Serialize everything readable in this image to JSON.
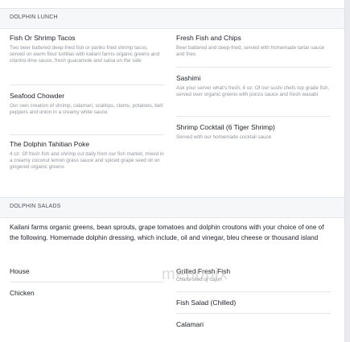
{
  "lunch": {
    "header": "DOLPHIN LUNCH",
    "left": [
      {
        "name": "Fish Or Shrimp Tacos",
        "desc": "Two beer battered deep-fried fish or panko fried shrimp tacos, served on warm flour tortillas with kailani farms organic greens and cilantro-lime sauce, fresh guacamole and salsa on the side"
      },
      {
        "name": "Seafood Chowder",
        "desc": "Our own creation of shrimp, calamari, scallops, clams, potatoes, bell peppers and onion in a creamy white sauce"
      },
      {
        "name": "The Dolphin Tahitian Poke",
        "desc": "4 oz. Of fresh fish and shrimp cut daily from our fish market, mixed in a creamy coconut lemon grass sauce and spiced grape seed oil on gingered organic greens"
      }
    ],
    "right": [
      {
        "name": "Fresh Fish and Chips",
        "desc": "Beer battered and deep-fried, served with homemade tartar sauce and fries"
      },
      {
        "name": "Sashimi",
        "desc": "Ask your server what's fresh, 4 oz. Of our sushi chefs top grade fish, served over organic greens with ponzu sauce and fresh wasabi"
      },
      {
        "name": "Shrimp Cocktail (6 Tiger Shrimp)",
        "desc": "Served with our homemade cocktail sauce"
      }
    ]
  },
  "salads": {
    "header": "DOLPHIN SALADS",
    "intro": "Kailani farms organic greens, bean sprouts, grape tomatoes and dolphin croutons with your choice of one of the following. Homemade dolphin dressing, which include, oil and vinegar, bleu cheese or thousand island",
    "left": [
      {
        "name": "House"
      },
      {
        "name": "Chicken"
      }
    ],
    "right": [
      {
        "name": "Grilled Fresh Fish",
        "desc": "Charbroiled or cajun"
      },
      {
        "name": "Fish Salad (Chilled)"
      },
      {
        "name": "Calamari"
      }
    ]
  },
  "watermark": "menupix"
}
